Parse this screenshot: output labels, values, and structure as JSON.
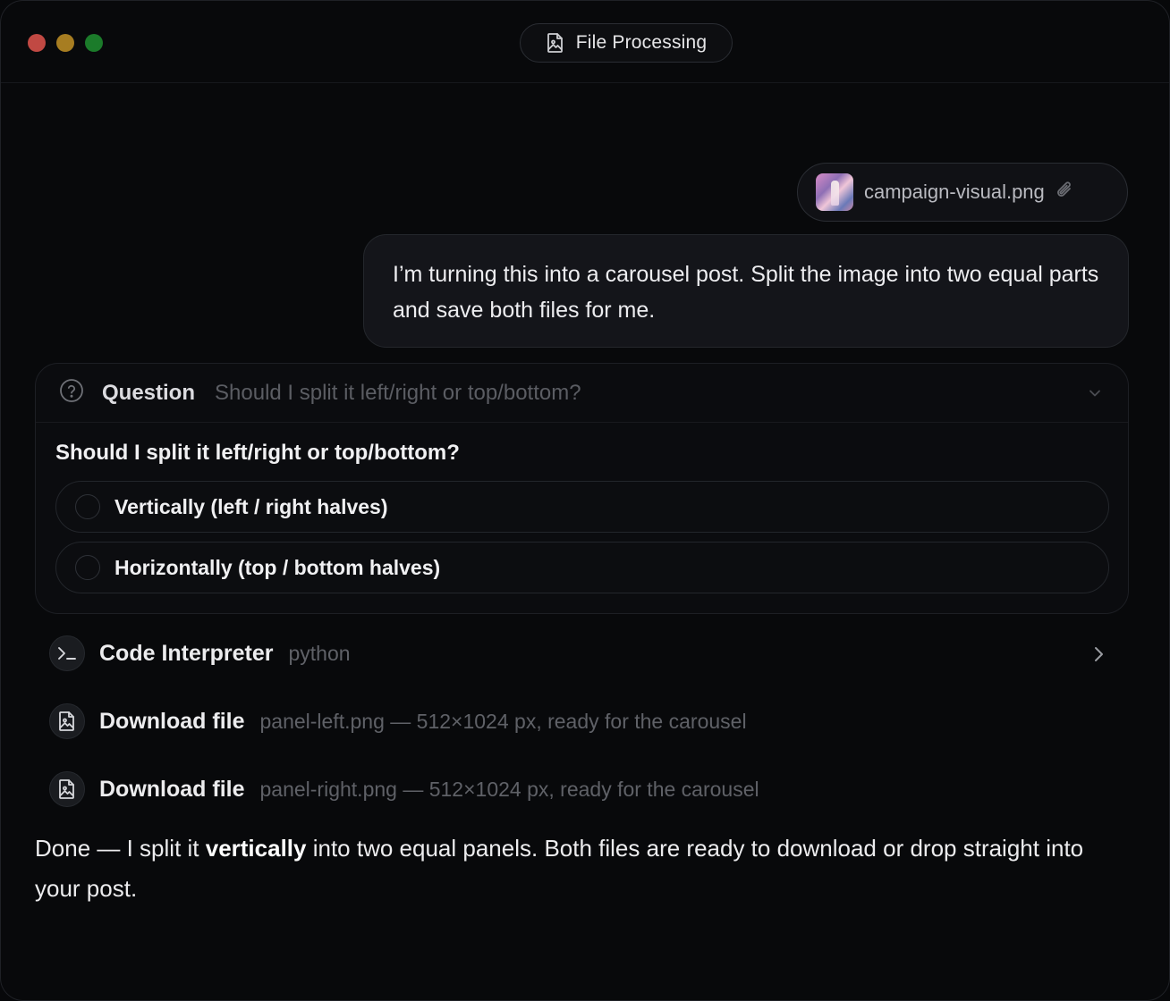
{
  "window": {
    "title": "File Processing",
    "title_icon": "file-image-icon"
  },
  "attachment": {
    "filename": "campaign-visual.png",
    "thumbnail": "image-thumbnail",
    "icon": "paperclip-icon"
  },
  "user_message": {
    "text": "I’m turning this into a carousel post. Split the image into two equal parts and save both files for me."
  },
  "question": {
    "icon": "question-circle-icon",
    "label": "Question",
    "summary": "Should I split it left/right or top/bottom?",
    "prompt": "Should I split it left/right or top/bottom?",
    "options": [
      {
        "label": "Vertically (left / right halves)",
        "selected": false
      },
      {
        "label": "Horizontally (top / bottom halves)",
        "selected": false
      }
    ],
    "expand_icon": "chevron-down-icon"
  },
  "tools": [
    {
      "icon": "terminal-icon",
      "name": "Code Interpreter",
      "meta": "python",
      "chevron": "chevron-right-icon"
    },
    {
      "icon": "file-image-icon",
      "name": "Download file",
      "meta": "panel-left.png — 512×1024 px, ready for the carousel"
    },
    {
      "icon": "file-image-icon",
      "name": "Download file",
      "meta": "panel-right.png — 512×1024 px, ready for the carousel"
    }
  ],
  "assistant_reply": {
    "before": "Done — I split it ",
    "emphasis": "vertically",
    "after": " into two equal panels. Both files are ready to download or drop straight into your post."
  },
  "colors": {
    "background": "#08090b",
    "bubble": "#14151a",
    "muted_text": "#5f6167",
    "traffic_red": "#ff5f57",
    "traffic_yellow": "#febc2e",
    "traffic_green": "#28c840"
  }
}
